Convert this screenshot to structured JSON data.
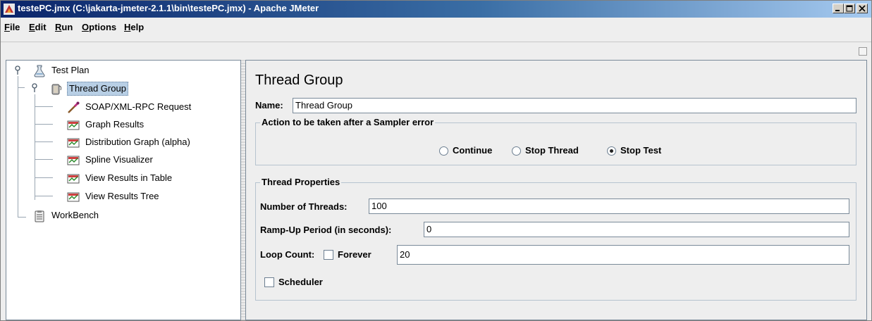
{
  "window": {
    "title": "testePC.jmx (C:\\jakarta-jmeter-2.1.1\\bin\\testePC.jmx) - Apache JMeter",
    "controls": [
      "minimize-icon",
      "maximize-icon",
      "close-icon"
    ]
  },
  "menu": [
    {
      "label": "File",
      "mnemonic": "F",
      "rest": "ile"
    },
    {
      "label": "Edit",
      "mnemonic": "E",
      "rest": "dit"
    },
    {
      "label": "Run",
      "mnemonic": "R",
      "rest": "un"
    },
    {
      "label": "Options",
      "mnemonic": "O",
      "rest": "ptions"
    },
    {
      "label": "Help",
      "mnemonic": "H",
      "rest": "elp"
    }
  ],
  "tree": {
    "test_plan": "Test Plan",
    "thread_group": "Thread Group",
    "children": [
      {
        "label": "SOAP/XML-RPC Request",
        "icon": "pipette-icon"
      },
      {
        "label": "Graph Results",
        "icon": "graph-icon"
      },
      {
        "label": "Distribution Graph (alpha)",
        "icon": "graph-icon"
      },
      {
        "label": "Spline Visualizer",
        "icon": "graph-icon"
      },
      {
        "label": "View Results in Table",
        "icon": "graph-icon"
      },
      {
        "label": "View Results Tree",
        "icon": "graph-icon"
      }
    ],
    "workbench": "WorkBench"
  },
  "panel": {
    "title": "Thread Group",
    "name_label": "Name:",
    "name_value": "Thread Group",
    "action_legend": "Action to be taken after a Sampler error",
    "actions": {
      "continue": "Continue",
      "stop_thread": "Stop Thread",
      "stop_test": "Stop Test",
      "selected": "Stop Test"
    },
    "props_legend": "Thread Properties",
    "threads_label": "Number of Threads:",
    "threads_value": "100",
    "rampup_label": "Ramp-Up Period (in seconds):",
    "rampup_value": "0",
    "loop_label": "Loop Count:",
    "forever_label": "Forever",
    "forever_checked": false,
    "loop_value": "20",
    "scheduler_label": "Scheduler",
    "scheduler_checked": false
  },
  "colors": {
    "titlebar_start": "#0a246a",
    "titlebar_end": "#a6caf0",
    "selection": "#b8cfe5"
  }
}
